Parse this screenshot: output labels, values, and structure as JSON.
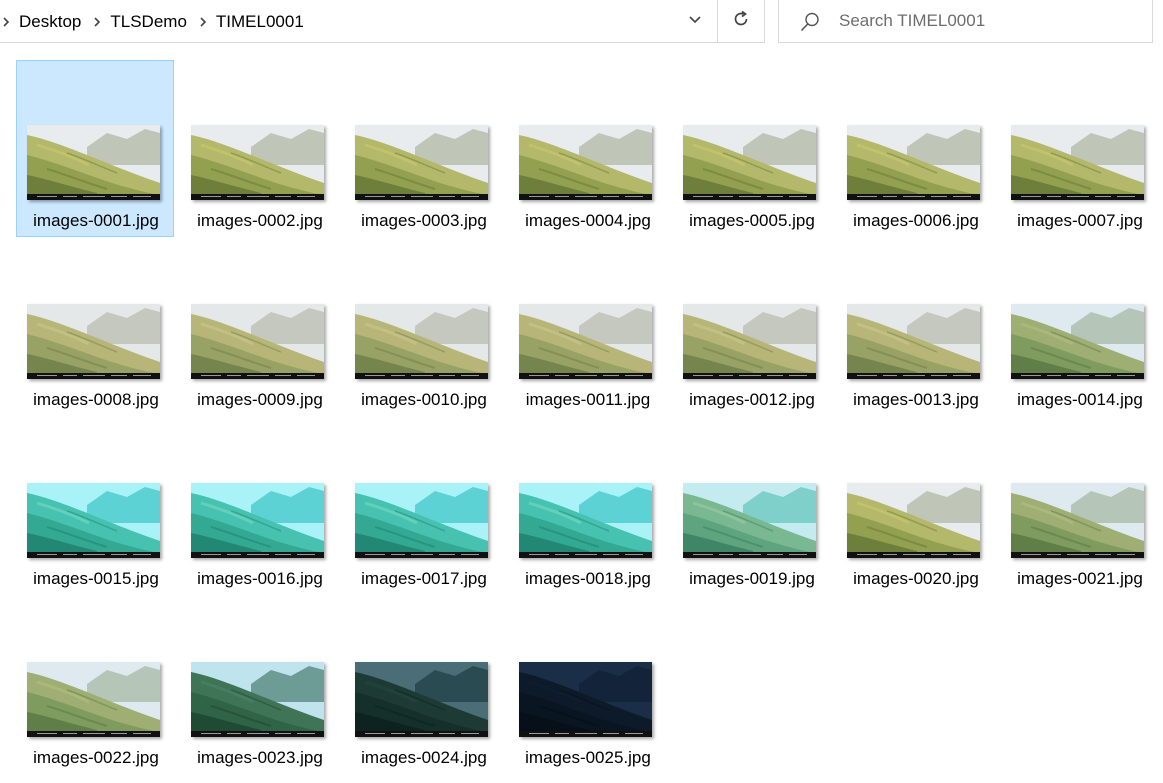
{
  "address_bar": {
    "breadcrumbs": [
      "Desktop",
      "TLSDemo",
      "TIMEL0001"
    ]
  },
  "search": {
    "placeholder": "Search TIMEL0001"
  },
  "icons": {
    "separator": "chevron-right-icon",
    "dropdown": "chevron-down-icon",
    "refresh": "refresh-icon",
    "search": "search-icon"
  },
  "colors": {
    "selection_fill": "#cce8ff",
    "selection_border": "#99d1ff"
  },
  "files": [
    {
      "name": "images-0001.jpg",
      "tone": "yellow",
      "selected": true
    },
    {
      "name": "images-0002.jpg",
      "tone": "yellow"
    },
    {
      "name": "images-0003.jpg",
      "tone": "yellow"
    },
    {
      "name": "images-0004.jpg",
      "tone": "yellow"
    },
    {
      "name": "images-0005.jpg",
      "tone": "yellow"
    },
    {
      "name": "images-0006.jpg",
      "tone": "yellow"
    },
    {
      "name": "images-0007.jpg",
      "tone": "yellow"
    },
    {
      "name": "images-0008.jpg",
      "tone": "hazy"
    },
    {
      "name": "images-0009.jpg",
      "tone": "hazy"
    },
    {
      "name": "images-0010.jpg",
      "tone": "hazy"
    },
    {
      "name": "images-0011.jpg",
      "tone": "hazy"
    },
    {
      "name": "images-0012.jpg",
      "tone": "hazy"
    },
    {
      "name": "images-0013.jpg",
      "tone": "hazy"
    },
    {
      "name": "images-0014.jpg",
      "tone": "green"
    },
    {
      "name": "images-0015.jpg",
      "tone": "cyan"
    },
    {
      "name": "images-0016.jpg",
      "tone": "cyan"
    },
    {
      "name": "images-0017.jpg",
      "tone": "cyan"
    },
    {
      "name": "images-0018.jpg",
      "tone": "cyan"
    },
    {
      "name": "images-0019.jpg",
      "tone": "cyanlight"
    },
    {
      "name": "images-0020.jpg",
      "tone": "yellow"
    },
    {
      "name": "images-0021.jpg",
      "tone": "green"
    },
    {
      "name": "images-0022.jpg",
      "tone": "green"
    },
    {
      "name": "images-0023.jpg",
      "tone": "dusk"
    },
    {
      "name": "images-0024.jpg",
      "tone": "dark"
    },
    {
      "name": "images-0025.jpg",
      "tone": "night"
    }
  ]
}
